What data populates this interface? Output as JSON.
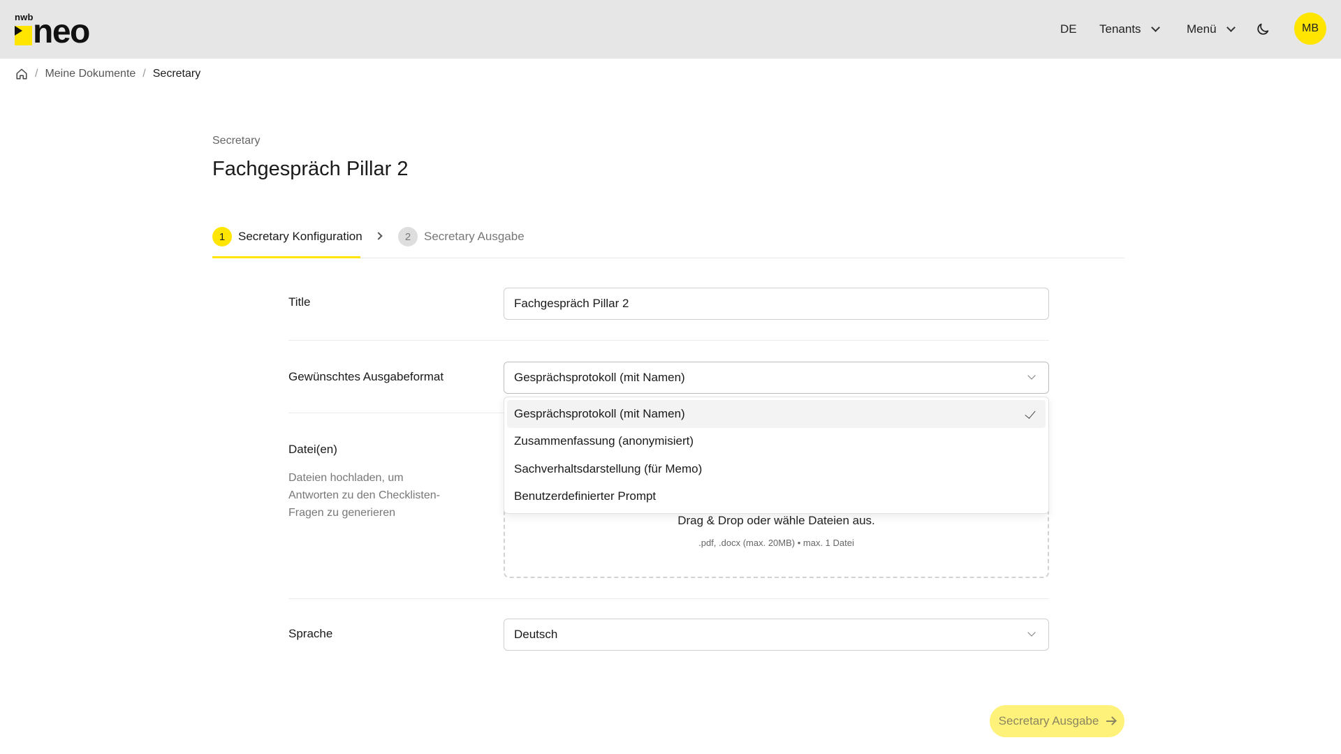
{
  "header": {
    "logo_small": "nwb",
    "logo_main": "neo",
    "lang": "DE",
    "tenants": "Tenants",
    "menu": "Menü",
    "avatar_initials": "MB",
    "accent_color": "#ffe500"
  },
  "breadcrumb": {
    "items": [
      "Meine Dokumente",
      "Secretary"
    ]
  },
  "page": {
    "eyebrow": "Secretary",
    "title": "Fachgespräch Pillar 2"
  },
  "stepper": {
    "steps": [
      {
        "number": "1",
        "label": "Secretary Konfiguration",
        "active": true
      },
      {
        "number": "2",
        "label": "Secretary Ausgabe",
        "active": false
      }
    ]
  },
  "form": {
    "title": {
      "label": "Title",
      "value": "Fachgespräch Pillar 2"
    },
    "format": {
      "label": "Gewünschtes Ausgabeformat",
      "value": "Gesprächsprotokoll (mit Namen)",
      "options": [
        "Gesprächsprotokoll (mit Namen)",
        "Zusammenfassung (anonymisiert)",
        "Sachverhaltsdarstellung (für Memo)",
        "Benutzerdefinierter Prompt"
      ]
    },
    "files": {
      "label": "Datei(en)",
      "help": "Dateien hochladen, um Antworten zu den Checklisten-Fragen zu generieren",
      "drop_main": "Drag & Drop oder wähle Dateien aus.",
      "drop_sub": ".pdf, .docx (max. 20MB) • max. 1 Datei"
    },
    "language": {
      "label": "Sprache",
      "value": "Deutsch"
    }
  },
  "actions": {
    "next_label": "Secretary Ausgabe"
  }
}
